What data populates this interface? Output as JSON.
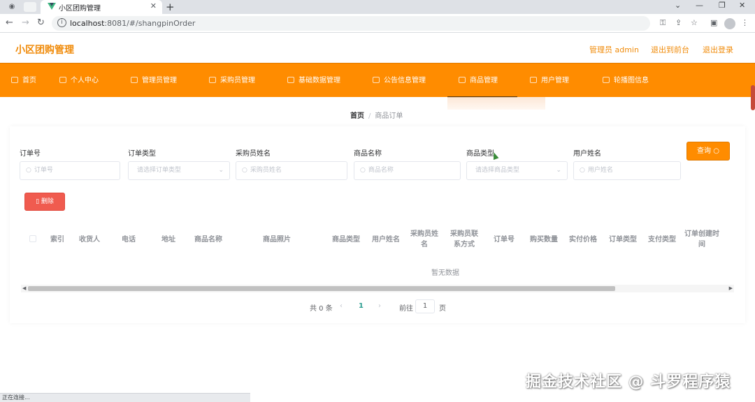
{
  "browser": {
    "tab_title": "小区团购管理",
    "url_host": "localhost",
    "url_path": ":8081/#/shangpinOrder"
  },
  "header": {
    "title": "小区团购管理",
    "user": "管理员 admin",
    "to_front": "退出到前台",
    "logout": "退出登录"
  },
  "nav": {
    "items": [
      {
        "label": "首页",
        "icon": "home-icon"
      },
      {
        "label": "个人中心",
        "icon": "user-icon"
      },
      {
        "label": "管理员管理",
        "icon": "list-icon"
      },
      {
        "label": "采购员管理",
        "icon": "list-icon"
      },
      {
        "label": "基础数据管理",
        "icon": "list-icon"
      },
      {
        "label": "公告信息管理",
        "icon": "list-icon"
      },
      {
        "label": "商品管理",
        "icon": "list-icon"
      },
      {
        "label": "用户管理",
        "icon": "list-icon"
      },
      {
        "label": "轮播图信息",
        "icon": "list-icon"
      }
    ],
    "active": "商品管理"
  },
  "breadcrumb": {
    "home": "首页",
    "separator": "/",
    "current": "商品订单"
  },
  "filters": {
    "order_no": {
      "label": "订单号",
      "placeholder": "订单号"
    },
    "order_type": {
      "label": "订单类型",
      "placeholder": "请选择订单类型"
    },
    "buyer_name": {
      "label": "采购员姓名",
      "placeholder": "采购员姓名"
    },
    "product_name": {
      "label": "商品名称",
      "placeholder": "商品名称"
    },
    "product_type": {
      "label": "商品类型",
      "placeholder": "请选择商品类型"
    },
    "user_name": {
      "label": "用户姓名",
      "placeholder": "用户姓名"
    }
  },
  "buttons": {
    "search": "查询",
    "delete": "删除"
  },
  "table": {
    "columns": [
      "索引",
      "收货人",
      "电话",
      "地址",
      "商品名称",
      "商品照片",
      "商品类型",
      "用户姓名",
      "采购员姓名",
      "采购员联系方式",
      "订单号",
      "购买数量",
      "实付价格",
      "订单类型",
      "支付类型",
      "订单创建时间"
    ],
    "empty_text": "暂无数据"
  },
  "pagination": {
    "total_text": "共 0 条",
    "current_page": "1",
    "goto_label": "前往",
    "goto_value": "1",
    "page_suffix": "页"
  },
  "status_bar": "正在连接...",
  "watermark": "掘金技术社区 @ 斗罗程序猿",
  "colors": {
    "accent": "#ff8c00",
    "header_text": "#f08b0a",
    "danger": "#f05b4f"
  }
}
